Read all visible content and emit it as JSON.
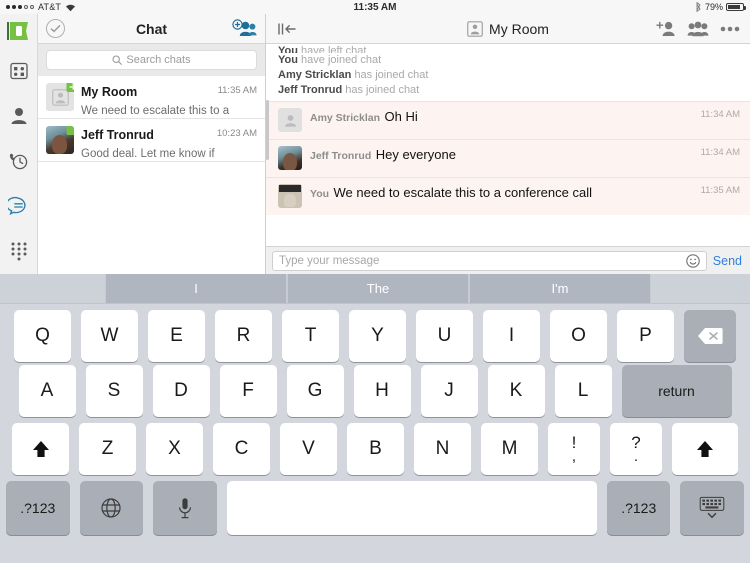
{
  "statusbar": {
    "carrier": "AT&T",
    "time": "11:35 AM",
    "battery_percent": "79%",
    "wifi_icon": "wifi-icon",
    "bluetooth_icon": "bluetooth-icon"
  },
  "rail": {
    "items": [
      {
        "name": "apps-icon"
      },
      {
        "name": "contacts-icon"
      },
      {
        "name": "call-history-icon"
      },
      {
        "name": "chat-icon"
      },
      {
        "name": "dialpad-icon"
      }
    ]
  },
  "chat_list": {
    "title": "Chat",
    "check_icon": "checkmark-circle-icon",
    "add_people_icon": "add-people-icon",
    "search": {
      "placeholder": "Search chats",
      "icon": "search-icon"
    },
    "rows": [
      {
        "name": "My Room",
        "preview": "We need to escalate this to a",
        "time": "11:35 AM",
        "avatar": "room-placeholder-avatar",
        "presence": "presence-forward-green"
      },
      {
        "name": "Jeff Tronrud",
        "preview": "Good deal.  Let me know if",
        "time": "10:23 AM",
        "avatar": "jeff-photo-avatar",
        "presence": "presence-available-green"
      }
    ]
  },
  "conversation": {
    "title": "My Room",
    "title_icon": "room-avatar-icon",
    "collapse_icon": "collapse-panel-icon",
    "actions": [
      {
        "name": "add-participant-icon"
      },
      {
        "name": "participants-icon"
      },
      {
        "name": "more-options-icon"
      }
    ],
    "system_messages": [
      {
        "actor": "You",
        "text": "have left chat",
        "clipped": true
      },
      {
        "actor": "You",
        "text": "have joined chat",
        "clipped": false
      },
      {
        "actor": "Amy Stricklan",
        "text": "has joined chat",
        "clipped": false
      },
      {
        "actor": "Jeff Tronrud",
        "text": "has joined chat",
        "clipped": false
      }
    ],
    "messages": [
      {
        "sender": "Amy Stricklan",
        "text": "Oh Hi",
        "time": "11:34 AM",
        "avatar": "amy-placeholder-avatar"
      },
      {
        "sender": "Jeff Tronrud",
        "text": "Hey everyone",
        "time": "11:34 AM",
        "avatar": "jeff-photo-avatar"
      },
      {
        "sender": "You",
        "text": "We need to escalate this to a conference call",
        "time": "11:35 AM",
        "avatar": "you-photo-avatar"
      }
    ],
    "input": {
      "placeholder": "Type your message",
      "emoji_icon": "emoji-icon",
      "send_label": "Send"
    }
  },
  "keyboard": {
    "predictions": [
      "I",
      "The",
      "I'm"
    ],
    "row1": [
      "Q",
      "W",
      "E",
      "R",
      "T",
      "Y",
      "U",
      "I",
      "O",
      "P"
    ],
    "row1_action": {
      "label": "",
      "name": "backspace-key",
      "icon": "backspace-icon"
    },
    "row2": [
      "A",
      "S",
      "D",
      "F",
      "G",
      "H",
      "J",
      "K",
      "L"
    ],
    "row2_action": {
      "label": "return",
      "name": "return-key"
    },
    "row3": [
      "Z",
      "X",
      "C",
      "V",
      "B",
      "N",
      "M"
    ],
    "row3_punct": [
      {
        "top": "!",
        "bot": ","
      },
      {
        "top": "?",
        "bot": "."
      }
    ],
    "shift_left": {
      "name": "shift-key-left",
      "icon": "shift-icon"
    },
    "shift_right": {
      "name": "shift-key-right",
      "icon": "shift-icon"
    },
    "row4": {
      "numbers_left": ".?123",
      "globe": "globe-icon",
      "mic": "microphone-icon",
      "space": "",
      "numbers_right": ".?123",
      "hide_keyboard": "hide-keyboard-icon"
    }
  },
  "colors": {
    "accent_blue": "#1d6f99",
    "send_blue": "#2f7fe0",
    "message_bg": "#fdf4f1",
    "keyboard_bg": "#d3d6dc",
    "presence_green": "#6abf3f"
  }
}
